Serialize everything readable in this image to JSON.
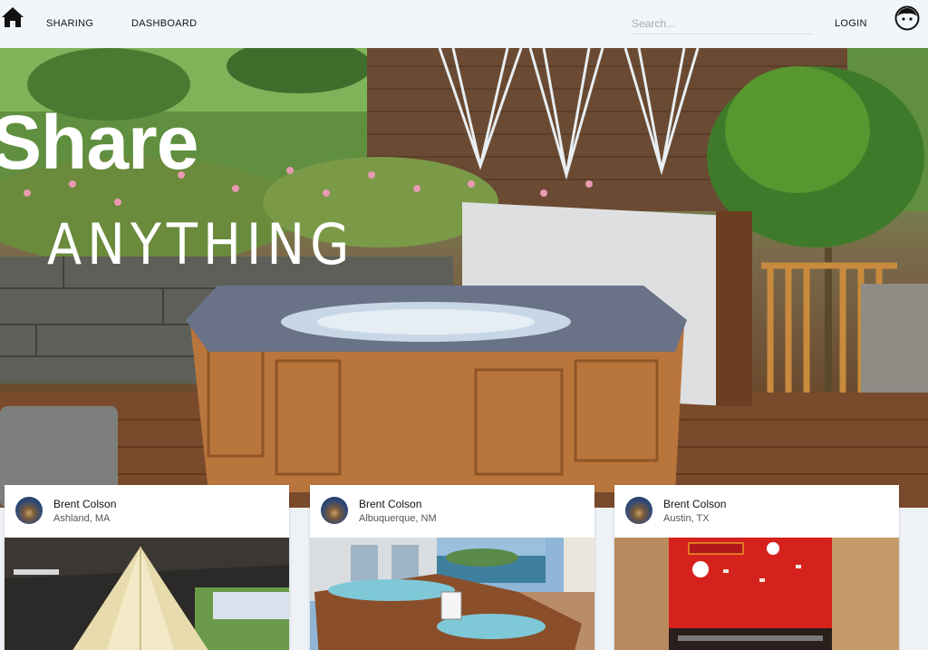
{
  "nav": {
    "home_icon": "home-icon",
    "links": [
      {
        "label": "SHARING"
      },
      {
        "label": "DASHBOARD"
      }
    ],
    "search_placeholder": "Search...",
    "login_label": "LOGIN",
    "avatar_icon": "user-face-icon"
  },
  "hero": {
    "title": "Share",
    "subtitle": "ANYTHING"
  },
  "listings": [
    {
      "owner": "Brent Colson",
      "location": "Ashland, MA"
    },
    {
      "owner": "Brent Colson",
      "location": "Albuquerque, NM"
    },
    {
      "owner": "Brent Colson",
      "location": "Austin, TX"
    }
  ]
}
